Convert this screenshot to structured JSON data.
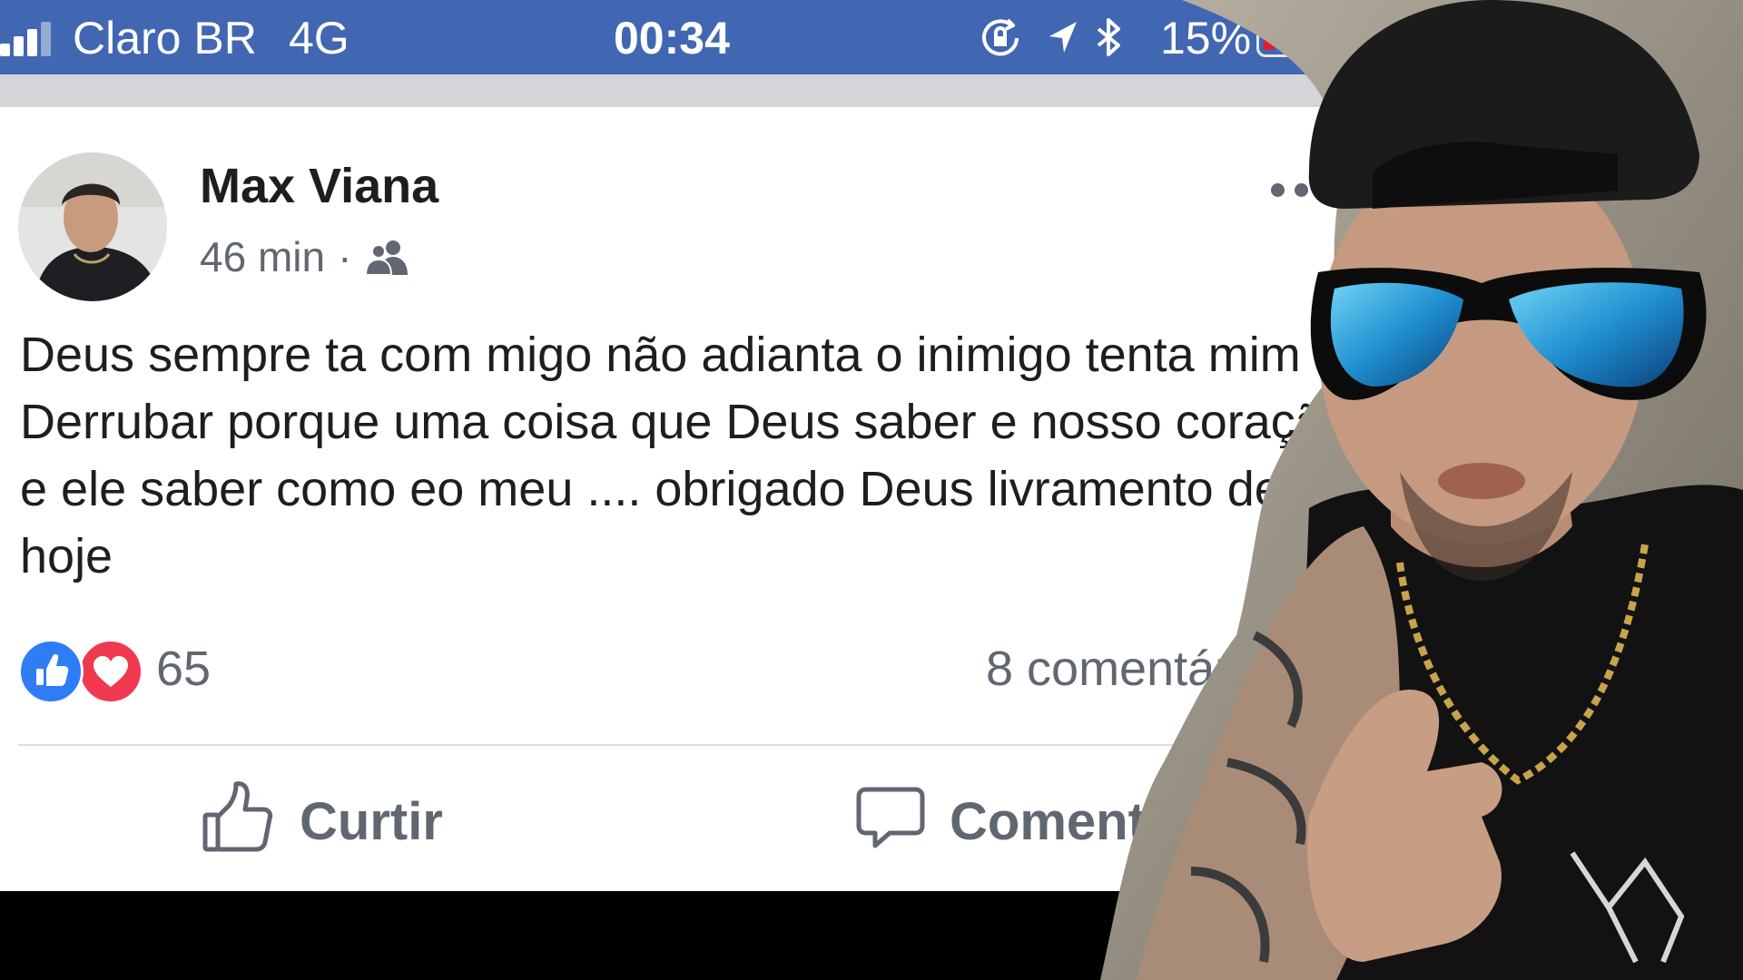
{
  "status_bar": {
    "carrier": "Claro BR",
    "network": "4G",
    "time": "00:34",
    "battery_percent": "15%",
    "battery_level": 0.15,
    "icons": [
      "signal-icon",
      "rotation-lock-icon",
      "location-arrow-icon",
      "bluetooth-icon",
      "battery-icon"
    ]
  },
  "post": {
    "author": "Max Viana",
    "time": "46 min",
    "separator": "·",
    "audience_icon": "friends-icon",
    "text": "Deus sempre ta com migo não adianta o inimigo tenta mim Derrubar porque uma coisa que Deus saber e nosso coração e ele saber como eo meu .... obrigado Deus livramento de hoje",
    "reaction_count": "65",
    "reactions": [
      "like-icon",
      "love-icon"
    ],
    "comment_count": "8 comentários"
  },
  "actions": {
    "like_label": "Curtir",
    "comment_label": "Comentar"
  },
  "colors": {
    "status_bar": "#4167b2",
    "like_blue": "#2e7df6",
    "love_red": "#f0394f",
    "battery_low": "#e8192e",
    "muted_text": "#616770"
  }
}
